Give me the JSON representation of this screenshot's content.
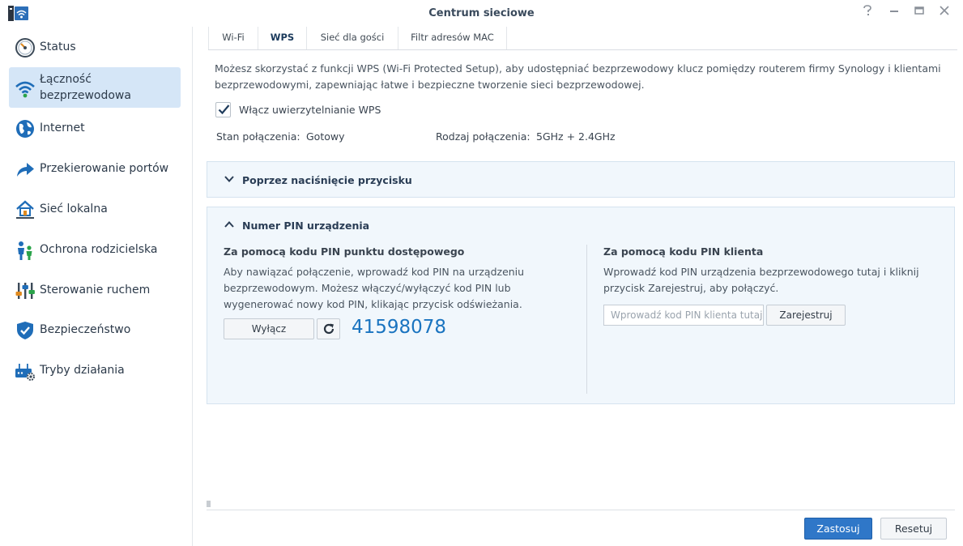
{
  "window": {
    "title": "Centrum sieciowe",
    "controls": [
      "help-icon",
      "minimize-icon",
      "maximize-icon",
      "close-icon"
    ]
  },
  "sidebar": {
    "items": [
      {
        "label": "Status",
        "icon": "gauge-icon"
      },
      {
        "label": "Łączność bezprzewodowa",
        "icon": "wifi-icon",
        "active": true
      },
      {
        "label": "Internet",
        "icon": "globe-icon"
      },
      {
        "label": "Przekierowanie portów",
        "icon": "forward-arrow-icon"
      },
      {
        "label": "Sieć lokalna",
        "icon": "home-network-icon"
      },
      {
        "label": "Ochrona rodzicielska",
        "icon": "family-icon"
      },
      {
        "label": "Sterowanie ruchem",
        "icon": "sliders-icon"
      },
      {
        "label": "Bezpieczeństwo",
        "icon": "shield-icon"
      },
      {
        "label": "Tryby działania",
        "icon": "router-gear-icon"
      }
    ]
  },
  "tabs": [
    {
      "label": "Wi-Fi"
    },
    {
      "label": "WPS",
      "active": true
    },
    {
      "label": "Sieć dla gości"
    },
    {
      "label": "Filtr adresów MAC"
    }
  ],
  "wps": {
    "description": "Możesz skorzystać z funkcji WPS (Wi-Fi Protected Setup), aby udostępniać bezprzewodowy klucz pomiędzy routerem firmy Synology i klientami bezprzewodowymi, zapewniając łatwe i bezpieczne tworzenie sieci bezprzewodowej.",
    "enable_label": "Włącz uwierzytelnianie WPS",
    "enabled": true,
    "status_label": "Stan połączenia:",
    "status_value": "Gotowy",
    "type_label": "Rodzaj połączenia:",
    "type_value": "5GHz + 2.4GHz"
  },
  "push_button_panel": {
    "title": "Poprzez naciśnięcie przycisku"
  },
  "pin_panel": {
    "title": "Numer PIN urządzenia",
    "ap": {
      "title": "Za pomocą kodu PIN punktu dostępowego",
      "text": "Aby nawiązać połączenie, wprowadź kod PIN na urządzeniu bezprzewodowym. Możesz włączyć/wyłączyć kod PIN lub wygenerować nowy kod PIN, klikając przycisk odświeżania.",
      "disable_label": "Wyłącz",
      "pin": "41598078"
    },
    "client": {
      "title": "Za pomocą kodu PIN klienta",
      "text": "Wprowadź kod PIN urządzenia bezprzewodowego tutaj i kliknij przycisk Zarejestruj, aby połączyć.",
      "placeholder": "Wprowadź kod PIN klienta tutaj",
      "register_label": "Zarejestruj"
    }
  },
  "footer": {
    "apply_label": "Zastosuj",
    "reset_label": "Resetuj"
  },
  "colors": {
    "accent": "#2f77c8",
    "active_nav": "#d5e6f7",
    "pin_text": "#1a74c0",
    "panel_bg": "#f1f7fc"
  }
}
